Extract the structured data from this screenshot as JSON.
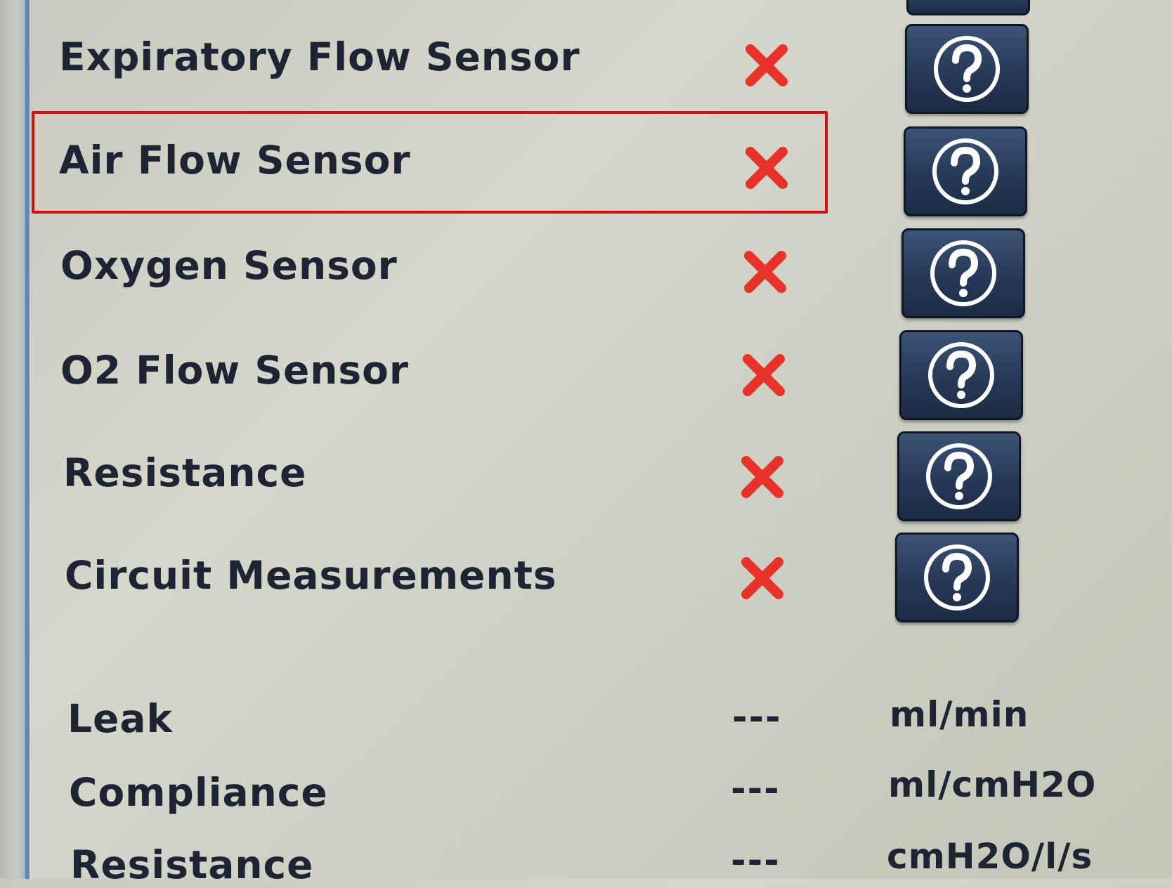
{
  "tests": [
    {
      "label": "Expiratory Flow Sensor",
      "status": "fail",
      "status_icon": "x-icon",
      "help_icon": "help-icon"
    },
    {
      "label": "Air Flow Sensor",
      "status": "fail",
      "status_icon": "x-icon",
      "help_icon": "help-icon",
      "highlighted": true
    },
    {
      "label": "Oxygen Sensor",
      "status": "fail",
      "status_icon": "x-icon",
      "help_icon": "help-icon"
    },
    {
      "label": "O2 Flow Sensor",
      "status": "fail",
      "status_icon": "x-icon",
      "help_icon": "help-icon"
    },
    {
      "label": "Resistance",
      "status": "fail",
      "status_icon": "x-icon",
      "help_icon": "help-icon"
    },
    {
      "label": "Circuit Measurements",
      "status": "fail",
      "status_icon": "x-icon",
      "help_icon": "help-icon"
    }
  ],
  "measurements": [
    {
      "label": "Leak",
      "value": "---",
      "unit": "ml/min"
    },
    {
      "label": "Compliance",
      "value": "---",
      "unit": "ml/cmH2O"
    },
    {
      "label": "Resistance",
      "value": "---",
      "unit": "cmH2O/l/s"
    }
  ],
  "colors": {
    "fail_icon": "#e8332a",
    "highlight_border": "#d01010",
    "button_bg": "#2a3d5c",
    "text": "#1d2535"
  }
}
